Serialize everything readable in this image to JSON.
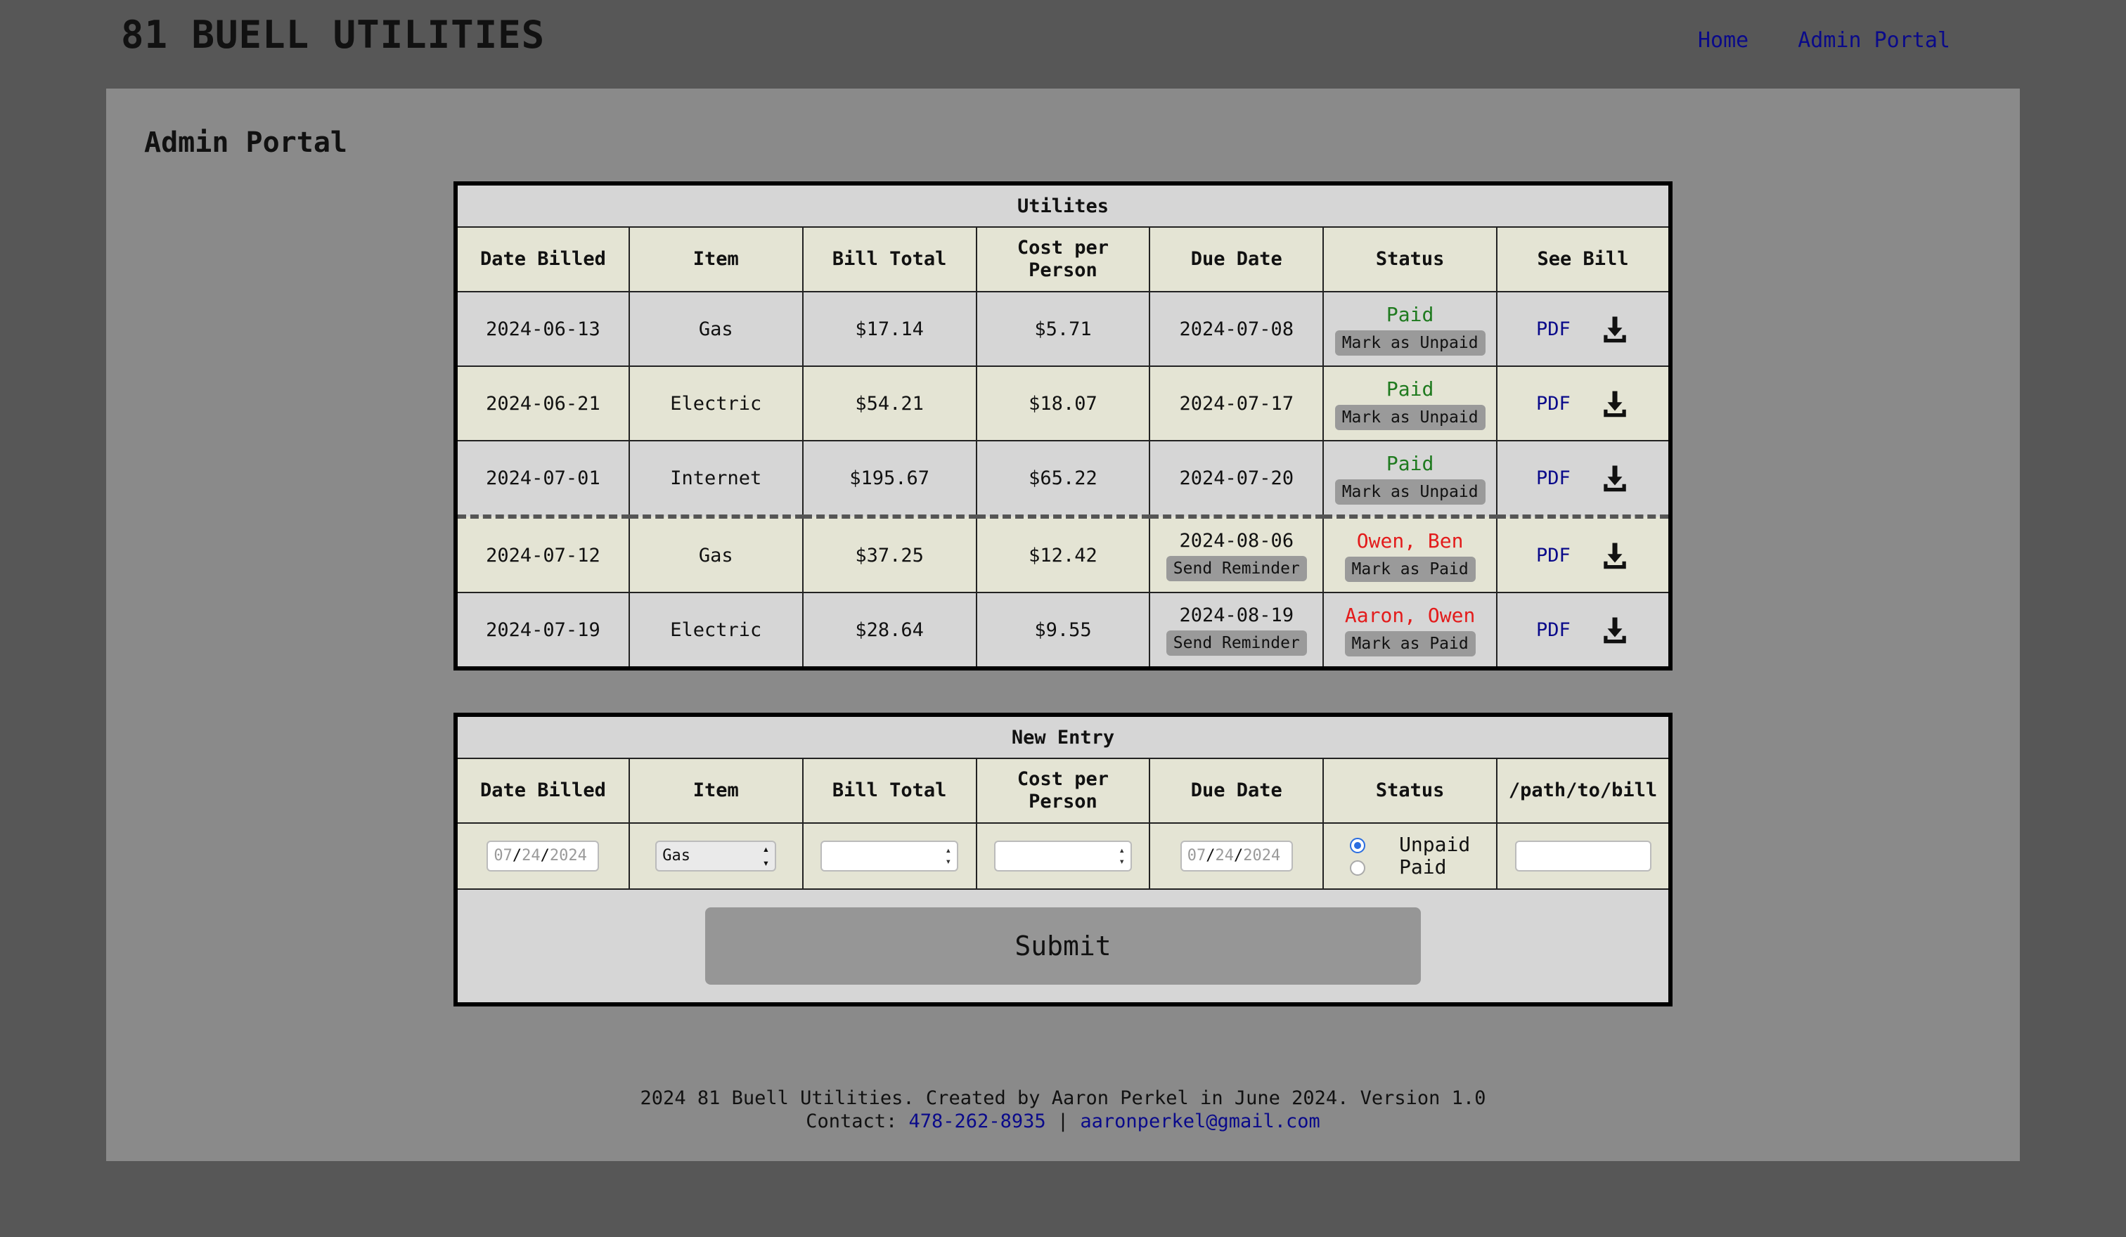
{
  "header": {
    "title": "81 BUELL UTILITIES",
    "nav": [
      {
        "label": "Home"
      },
      {
        "label": "Admin Portal"
      }
    ]
  },
  "page": {
    "title": "Admin Portal"
  },
  "utilities_table": {
    "caption": "Utilites",
    "columns": [
      "Date Billed",
      "Item",
      "Bill Total",
      "Cost per Person",
      "Due Date",
      "Status",
      "See Bill"
    ],
    "rows": [
      {
        "date_billed": "2024-06-13",
        "item": "Gas",
        "bill_total": "$17.14",
        "cost_per_person": "$5.71",
        "due_date": "2024-07-08",
        "status": "Paid",
        "status_button": "Mark as Unpaid",
        "bill_link": "PDF"
      },
      {
        "date_billed": "2024-06-21",
        "item": "Electric",
        "bill_total": "$54.21",
        "cost_per_person": "$18.07",
        "due_date": "2024-07-17",
        "status": "Paid",
        "status_button": "Mark as Unpaid",
        "bill_link": "PDF"
      },
      {
        "date_billed": "2024-07-01",
        "item": "Internet",
        "bill_total": "$195.67",
        "cost_per_person": "$65.22",
        "due_date": "2024-07-20",
        "status": "Paid",
        "status_button": "Mark as Unpaid",
        "bill_link": "PDF"
      },
      {
        "date_billed": "2024-07-12",
        "item": "Gas",
        "bill_total": "$37.25",
        "cost_per_person": "$12.42",
        "due_date": "2024-08-06",
        "due_button": "Send Reminder",
        "status": "Owen, Ben",
        "status_button": "Mark as Paid",
        "bill_link": "PDF"
      },
      {
        "date_billed": "2024-07-19",
        "item": "Electric",
        "bill_total": "$28.64",
        "cost_per_person": "$9.55",
        "due_date": "2024-08-19",
        "due_button": "Send Reminder",
        "status": "Aaron, Owen",
        "status_button": "Mark as Paid",
        "bill_link": "PDF"
      }
    ]
  },
  "new_entry": {
    "caption": "New Entry",
    "columns": [
      "Date Billed",
      "Item",
      "Bill Total",
      "Cost per Person",
      "Due Date",
      "Status",
      "/path/to/bill"
    ],
    "date_billed": {
      "mm": "07",
      "dd": "24",
      "yyyy": "2024"
    },
    "item_selected": "Gas",
    "bill_total_value": "",
    "cost_per_person_value": "",
    "due_date": {
      "mm": "07",
      "dd": "24",
      "yyyy": "2024"
    },
    "status_options": [
      "Unpaid",
      "Paid"
    ],
    "status_selected": "Unpaid",
    "path_value": "",
    "submit_label": "Submit"
  },
  "footer": {
    "line1": "2024 81 Buell Utilities. Created by Aaron Perkel in June 2024. Version 1.0",
    "contact_label": "Contact:",
    "phone": "478-262-8935",
    "separator": "|",
    "email": "aaronperkel@gmail.com"
  },
  "colors": {
    "paid": "#1f7a1f",
    "unpaid": "#e31b1b",
    "link": "#0a0a8a",
    "background": "#575757",
    "panel": "#8a8a8a"
  }
}
